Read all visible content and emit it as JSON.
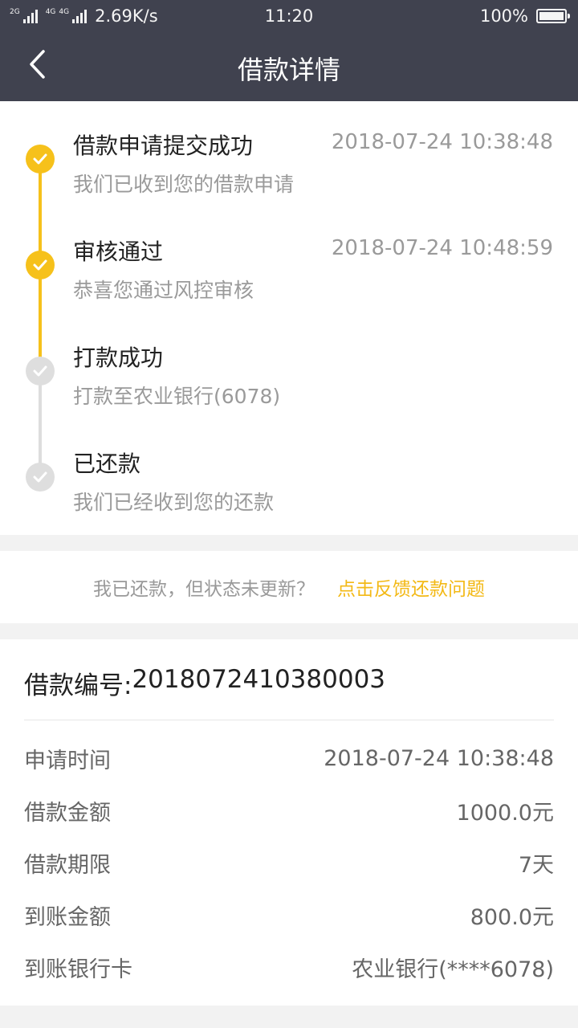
{
  "status_bar": {
    "net_tag_1": "2G",
    "net_tag_2": "4G",
    "net_tag_3": "4G",
    "speed": "2.69K/s",
    "time": "11:20",
    "battery": "100%"
  },
  "header": {
    "title": "借款详情"
  },
  "timeline": {
    "steps": [
      {
        "title": "借款申请提交成功",
        "desc": "我们已收到您的借款申请",
        "time": "2018-07-24 10:38:48",
        "done": true
      },
      {
        "title": "审核通过",
        "desc": "恭喜您通过风控审核",
        "time": "2018-07-24 10:48:59",
        "done": true
      },
      {
        "title": "打款成功",
        "desc": "打款至农业银行(6078)",
        "time": "",
        "done": false
      },
      {
        "title": "已还款",
        "desc": "我们已经收到您的还款",
        "time": "",
        "done": false
      }
    ]
  },
  "feedback": {
    "question": "我已还款，但状态未更新？",
    "link": "点击反馈还款问题"
  },
  "details": {
    "loan_no_label": "借款编号:",
    "loan_no": "2018072410380003",
    "rows": [
      {
        "label": "申请时间",
        "value": "2018-07-24 10:38:48"
      },
      {
        "label": "借款金额",
        "value": "1000.0元"
      },
      {
        "label": "借款期限",
        "value": "7天"
      },
      {
        "label": "到账金额",
        "value": "800.0元"
      },
      {
        "label": "到账银行卡",
        "value": "农业银行(****6078)"
      }
    ]
  },
  "colors": {
    "header_bg": "#40424f",
    "accent": "#f6c11b",
    "link": "#f3b916",
    "pending": "#dedede"
  }
}
